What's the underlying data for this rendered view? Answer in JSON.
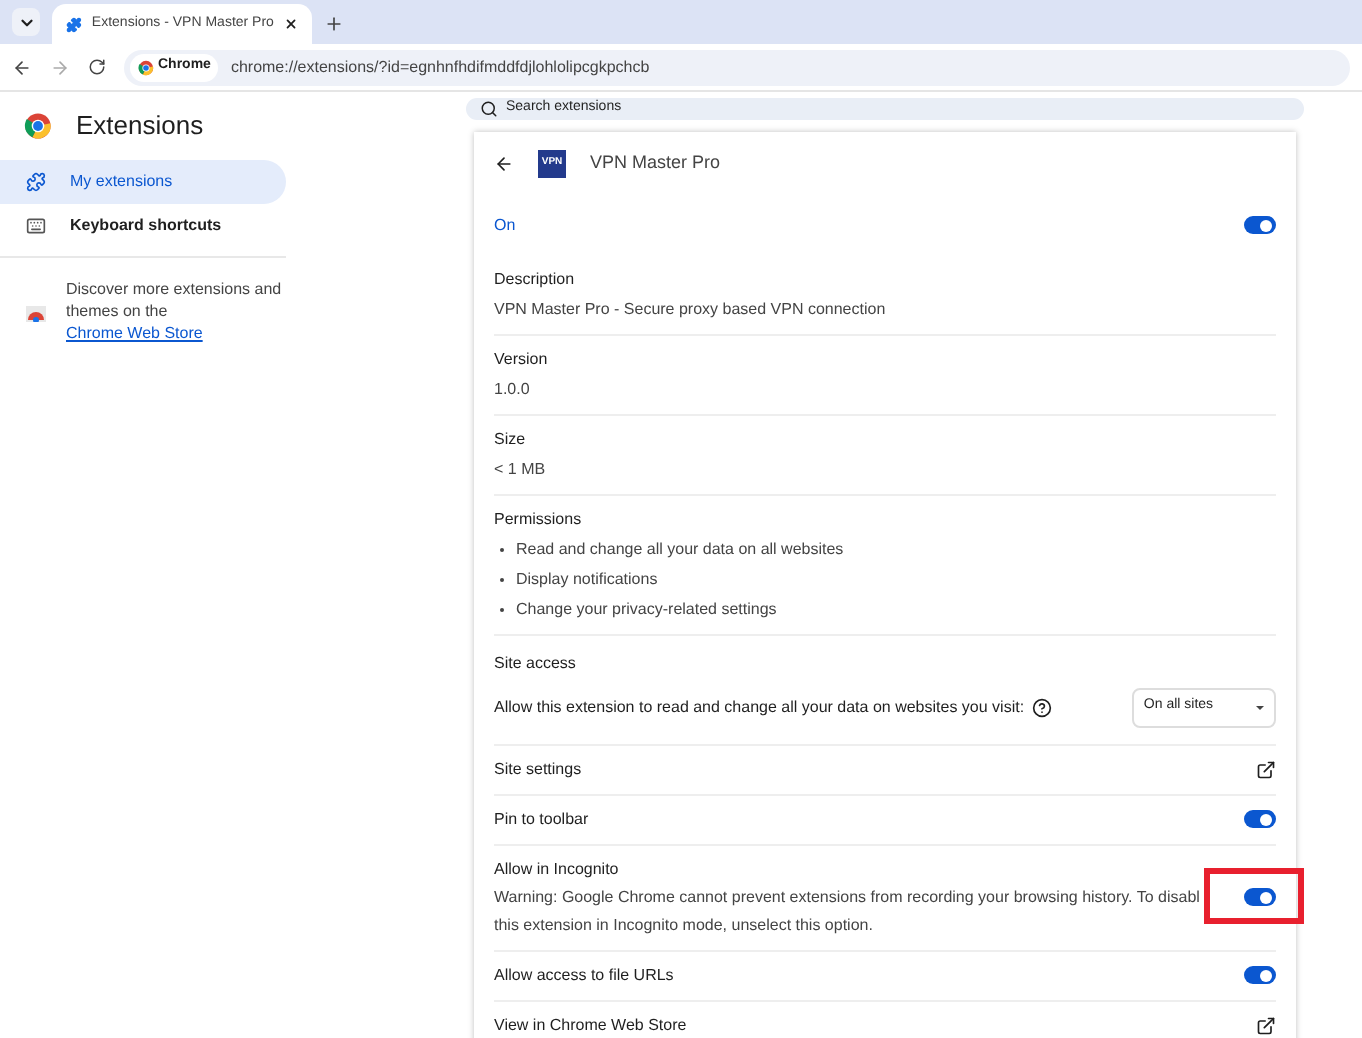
{
  "browser": {
    "tab_title": "Extensions - VPN Master Pro",
    "site_chip": "Chrome",
    "url": "chrome://extensions/?id=egnhnfhdifmddfdjlohlolipcgkpchcb"
  },
  "sidebar": {
    "title": "Extensions",
    "items": [
      {
        "label": "My extensions",
        "selected": true,
        "kind": "puzzle"
      },
      {
        "label": "Keyboard shortcuts",
        "selected": false,
        "kind": "keyboard"
      }
    ],
    "promo_text": "Discover more extensions and themes on the",
    "promo_link": "Chrome Web Store"
  },
  "search": {
    "placeholder": "Search extensions"
  },
  "extension": {
    "name": "VPN Master Pro",
    "icon_text": "VPN",
    "enabled_label": "On",
    "enabled": true,
    "details": [
      {
        "label": "Description",
        "values": [
          "VPN Master Pro - Secure proxy based VPN connection"
        ],
        "kind": "text"
      },
      {
        "label": "Version",
        "values": [
          "1.0.0"
        ],
        "kind": "text"
      },
      {
        "label": "Size",
        "values": [
          "< 1 MB"
        ],
        "kind": "text"
      },
      {
        "label": "Permissions",
        "values": [
          "Read and change all your data on all websites",
          "Display notifications",
          "Change your privacy-related settings"
        ],
        "kind": "list"
      }
    ],
    "site_access": {
      "title": "Site access",
      "prompt": "Allow this extension to read and change all your data on websites you visit:",
      "choice": "On all sites"
    },
    "options": [
      {
        "label": "Site settings",
        "kind": "link"
      },
      {
        "label": "Pin to toolbar",
        "kind": "toggle",
        "on": true,
        "highlighted": false
      },
      {
        "label": "Allow in Incognito",
        "kind": "toggle",
        "on": true,
        "highlighted": true,
        "warning_lines": [
          "Warning: Google Chrome cannot prevent extensions from recording your browsing history. To disabl",
          "this extension in Incognito mode, unselect this option."
        ]
      },
      {
        "label": "Allow access to file URLs",
        "kind": "toggle",
        "on": true,
        "highlighted": false
      },
      {
        "label": "View in Chrome Web Store",
        "kind": "link"
      }
    ]
  }
}
